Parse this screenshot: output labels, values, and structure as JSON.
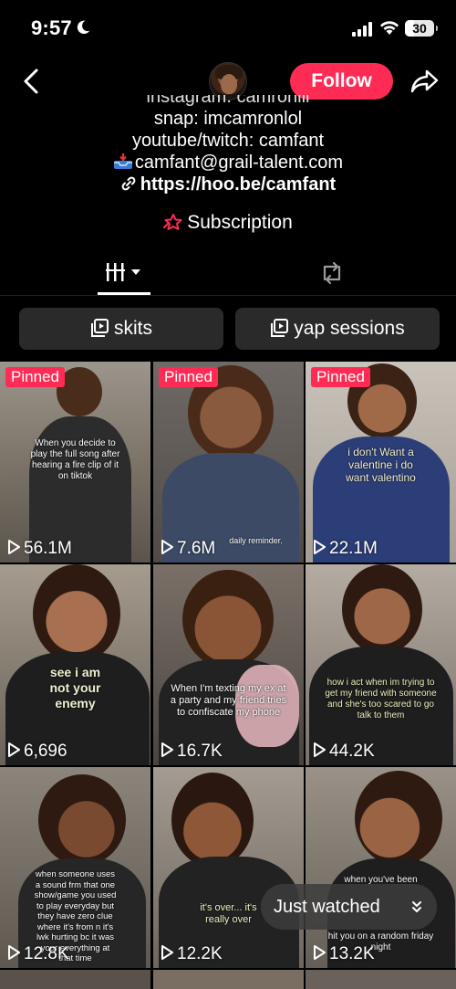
{
  "status_bar": {
    "time": "9:57",
    "battery": "30"
  },
  "header": {
    "follow_label": "Follow"
  },
  "bio": {
    "clipped_line": "instagram: camronlll",
    "snap": "snap: imcamronlol",
    "youtube": "youtube/twitch: camfant",
    "email": "camfant@grail-talent.com",
    "link": "https://hoo.be/camfant"
  },
  "subscription_label": "Subscription",
  "playlists": [
    {
      "label": "skits"
    },
    {
      "label": "yap sessions"
    }
  ],
  "videos": [
    {
      "pinned": "Pinned",
      "views": "56.1M",
      "caption": "When you decide to play the full song after hearing a fire clip of it on tiktok"
    },
    {
      "pinned": "Pinned",
      "views": "7.6M",
      "caption": "daily reminder."
    },
    {
      "pinned": "Pinned",
      "views": "22.1M",
      "caption": "i don't Want a valentine i do want valentino"
    },
    {
      "views": "6,696",
      "caption": "see i am not your enemy"
    },
    {
      "views": "16.7K",
      "caption": "When I'm texting my ex at a party and my friend tries to confiscate my phone"
    },
    {
      "views": "44.2K",
      "caption": "how i act when im trying to get my friend with someone and she's too scared to go talk to them"
    },
    {
      "views": "12.8K",
      "caption": "when someone uses a sound frm that one show/game you used to play everyday but they have zero clue where it's from n it's lwk hurting bc it was your everything at that time"
    },
    {
      "views": "12.2K",
      "caption": "it's over... it's really over"
    },
    {
      "views": "13.2K",
      "caption": "when you've been",
      "caption2": "hit you on a random friday night"
    }
  ],
  "just_watched_label": "Just watched",
  "colors": {
    "accent": "#fe2c55",
    "chip_bg": "#2a2a2a",
    "background": "#000000"
  }
}
